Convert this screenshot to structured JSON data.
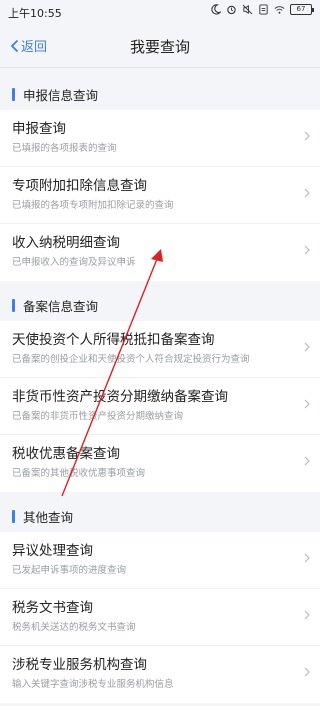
{
  "status": {
    "time": "上午10:55",
    "battery": "67",
    "icons": [
      "moon-icon",
      "alarm-icon",
      "mute-icon",
      "sim-icon",
      "wifi-icon",
      "battery-icon"
    ]
  },
  "nav": {
    "back_label": "返回",
    "title": "我要查询"
  },
  "sections": [
    {
      "header": "申报信息查询",
      "items": [
        {
          "title": "申报查询",
          "desc": "已填报的各项报表的查询"
        },
        {
          "title": "专项附加扣除信息查询",
          "desc": "已填报的各项专项附加扣除记录的查询"
        },
        {
          "title": "收入纳税明细查询",
          "desc": "已申报收入的查询及异议申诉"
        }
      ]
    },
    {
      "header": "备案信息查询",
      "items": [
        {
          "title": "天使投资个人所得税抵扣备案查询",
          "desc": "已备案的创投企业和天使投资个人符合规定投资行为查询"
        },
        {
          "title": "非货币性资产投资分期缴纳备案查询",
          "desc": "已备案的非货币性资产投资分期缴纳查询"
        },
        {
          "title": "税收优惠备案查询",
          "desc": "已备案的其他税收优惠事项查询"
        }
      ]
    },
    {
      "header": "其他查询",
      "items": [
        {
          "title": "异议处理查询",
          "desc": "已发起申诉事项的进度查询"
        },
        {
          "title": "税务文书查询",
          "desc": "税务机关送达的税务文书查询"
        },
        {
          "title": "涉税专业服务机构查询",
          "desc": "输入关键字查询涉税专业服务机构信息"
        }
      ]
    }
  ],
  "colors": {
    "accent": "#3d7ee8",
    "annotation_arrow": "#e02020"
  }
}
